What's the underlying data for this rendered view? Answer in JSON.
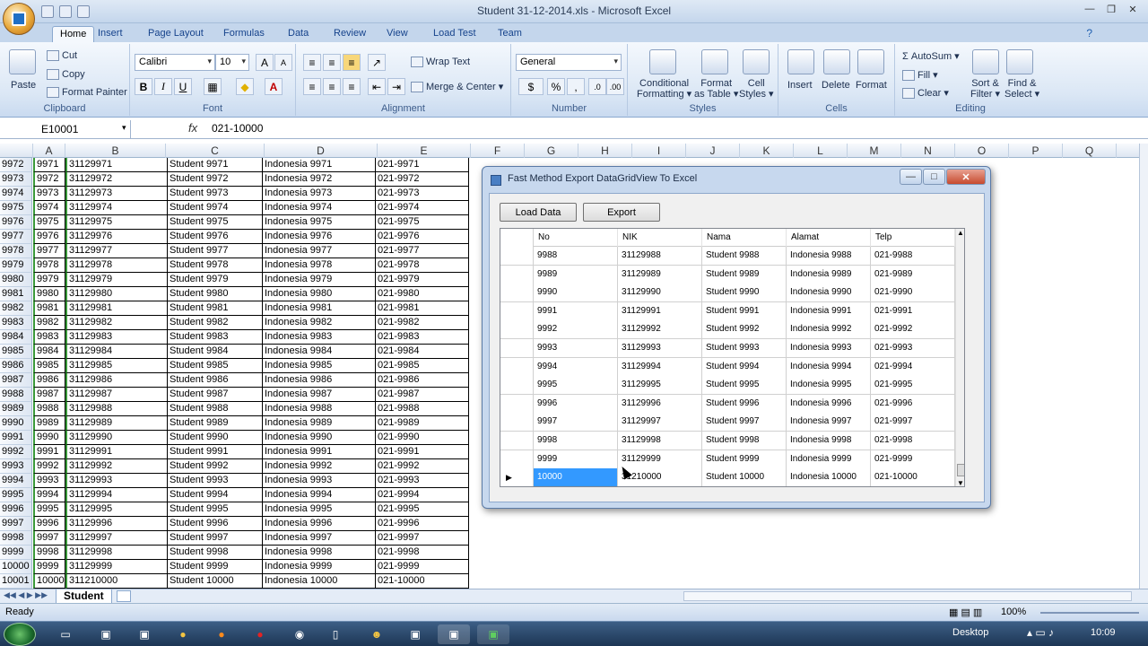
{
  "window": {
    "title": "Student 31-12-2014.xls - Microsoft Excel"
  },
  "ribbon": {
    "tabs": [
      "Home",
      "Insert",
      "Page Layout",
      "Formulas",
      "Data",
      "Review",
      "View",
      "Load Test",
      "Team"
    ],
    "clipboard": {
      "label": "Clipboard",
      "paste": "Paste",
      "cut": "Cut",
      "copy": "Copy",
      "format_painter": "Format Painter"
    },
    "font": {
      "label": "Font",
      "name": "Calibri",
      "size": "10",
      "bold": "B",
      "italic": "I",
      "underline": "U"
    },
    "alignment": {
      "label": "Alignment",
      "wrap_text": "Wrap Text",
      "merge_center": "Merge & Center"
    },
    "number": {
      "label": "Number",
      "format": "General",
      "percent": "%"
    },
    "styles": {
      "label": "Styles",
      "conditional": "Conditional",
      "conditional2": "Formatting",
      "format_table": "Format",
      "format_table2": "as Table",
      "cell_styles": "Cell",
      "cell_styles2": "Styles"
    },
    "cells": {
      "label": "Cells",
      "insert": "Insert",
      "delete": "Delete",
      "format": "Format"
    },
    "editing": {
      "label": "Editing",
      "autosum": "AutoSum",
      "fill": "Fill",
      "clear": "Clear",
      "sort_filter": "Sort &",
      "sort_filter2": "Filter",
      "find_select": "Find &",
      "find_select2": "Select"
    }
  },
  "formula_bar": {
    "name_box": "E10001",
    "fx": "fx",
    "formula": "021-10000"
  },
  "columns": [
    "A",
    "B",
    "C",
    "D",
    "E",
    "F",
    "G",
    "H",
    "I",
    "J",
    "K",
    "L",
    "M",
    "N",
    "O",
    "P",
    "Q"
  ],
  "sheet_rows": [
    [
      "9972",
      "9971",
      "31129971",
      "Student 9971",
      "Indonesia 9971",
      "021-9971"
    ],
    [
      "9973",
      "9972",
      "31129972",
      "Student 9972",
      "Indonesia 9972",
      "021-9972"
    ],
    [
      "9974",
      "9973",
      "31129973",
      "Student 9973",
      "Indonesia 9973",
      "021-9973"
    ],
    [
      "9975",
      "9974",
      "31129974",
      "Student 9974",
      "Indonesia 9974",
      "021-9974"
    ],
    [
      "9976",
      "9975",
      "31129975",
      "Student 9975",
      "Indonesia 9975",
      "021-9975"
    ],
    [
      "9977",
      "9976",
      "31129976",
      "Student 9976",
      "Indonesia 9976",
      "021-9976"
    ],
    [
      "9978",
      "9977",
      "31129977",
      "Student 9977",
      "Indonesia 9977",
      "021-9977"
    ],
    [
      "9979",
      "9978",
      "31129978",
      "Student 9978",
      "Indonesia 9978",
      "021-9978"
    ],
    [
      "9980",
      "9979",
      "31129979",
      "Student 9979",
      "Indonesia 9979",
      "021-9979"
    ],
    [
      "9981",
      "9980",
      "31129980",
      "Student 9980",
      "Indonesia 9980",
      "021-9980"
    ],
    [
      "9982",
      "9981",
      "31129981",
      "Student 9981",
      "Indonesia 9981",
      "021-9981"
    ],
    [
      "9983",
      "9982",
      "31129982",
      "Student 9982",
      "Indonesia 9982",
      "021-9982"
    ],
    [
      "9984",
      "9983",
      "31129983",
      "Student 9983",
      "Indonesia 9983",
      "021-9983"
    ],
    [
      "9985",
      "9984",
      "31129984",
      "Student 9984",
      "Indonesia 9984",
      "021-9984"
    ],
    [
      "9986",
      "9985",
      "31129985",
      "Student 9985",
      "Indonesia 9985",
      "021-9985"
    ],
    [
      "9987",
      "9986",
      "31129986",
      "Student 9986",
      "Indonesia 9986",
      "021-9986"
    ],
    [
      "9988",
      "9987",
      "31129987",
      "Student 9987",
      "Indonesia 9987",
      "021-9987"
    ],
    [
      "9989",
      "9988",
      "31129988",
      "Student 9988",
      "Indonesia 9988",
      "021-9988"
    ],
    [
      "9990",
      "9989",
      "31129989",
      "Student 9989",
      "Indonesia 9989",
      "021-9989"
    ],
    [
      "9991",
      "9990",
      "31129990",
      "Student 9990",
      "Indonesia 9990",
      "021-9990"
    ],
    [
      "9992",
      "9991",
      "31129991",
      "Student 9991",
      "Indonesia 9991",
      "021-9991"
    ],
    [
      "9993",
      "9992",
      "31129992",
      "Student 9992",
      "Indonesia 9992",
      "021-9992"
    ],
    [
      "9994",
      "9993",
      "31129993",
      "Student 9993",
      "Indonesia 9993",
      "021-9993"
    ],
    [
      "9995",
      "9994",
      "31129994",
      "Student 9994",
      "Indonesia 9994",
      "021-9994"
    ],
    [
      "9996",
      "9995",
      "31129995",
      "Student 9995",
      "Indonesia 9995",
      "021-9995"
    ],
    [
      "9997",
      "9996",
      "31129996",
      "Student 9996",
      "Indonesia 9996",
      "021-9996"
    ],
    [
      "9998",
      "9997",
      "31129997",
      "Student 9997",
      "Indonesia 9997",
      "021-9997"
    ],
    [
      "9999",
      "9998",
      "31129998",
      "Student 9998",
      "Indonesia 9998",
      "021-9998"
    ],
    [
      "10000",
      "9999",
      "31129999",
      "Student 9999",
      "Indonesia 9999",
      "021-9999"
    ],
    [
      "10001",
      "10000",
      "311210000",
      "Student 10000",
      "Indonesia 10000",
      "021-10000"
    ]
  ],
  "sheet_tab": "Student",
  "status": {
    "ready": "Ready",
    "zoom": "100%"
  },
  "dialog": {
    "title": "Fast Method Export DataGridView To Excel",
    "load_button": "Load Data",
    "export_button": "Export",
    "headers": [
      "No",
      "NIK",
      "Nama",
      "Alamat",
      "Telp"
    ],
    "rows": [
      [
        "9988",
        "31129988",
        "Student 9988",
        "Indonesia 9988",
        "021-9988"
      ],
      [
        "9989",
        "31129989",
        "Student 9989",
        "Indonesia 9989",
        "021-9989"
      ],
      [
        "9990",
        "31129990",
        "Student 9990",
        "Indonesia 9990",
        "021-9990"
      ],
      [
        "9991",
        "31129991",
        "Student 9991",
        "Indonesia 9991",
        "021-9991"
      ],
      [
        "9992",
        "31129992",
        "Student 9992",
        "Indonesia 9992",
        "021-9992"
      ],
      [
        "9993",
        "31129993",
        "Student 9993",
        "Indonesia 9993",
        "021-9993"
      ],
      [
        "9994",
        "31129994",
        "Student 9994",
        "Indonesia 9994",
        "021-9994"
      ],
      [
        "9995",
        "31129995",
        "Student 9995",
        "Indonesia 9995",
        "021-9995"
      ],
      [
        "9996",
        "31129996",
        "Student 9996",
        "Indonesia 9996",
        "021-9996"
      ],
      [
        "9997",
        "31129997",
        "Student 9997",
        "Indonesia 9997",
        "021-9997"
      ],
      [
        "9998",
        "31129998",
        "Student 9998",
        "Indonesia 9998",
        "021-9998"
      ],
      [
        "9999",
        "31129999",
        "Student 9999",
        "Indonesia 9999",
        "021-9999"
      ],
      [
        "10000",
        "31210000",
        "Student 10000",
        "Indonesia 10000",
        "021-10000"
      ]
    ]
  },
  "taskbar": {
    "desktop": "Desktop",
    "time": "10:09"
  }
}
